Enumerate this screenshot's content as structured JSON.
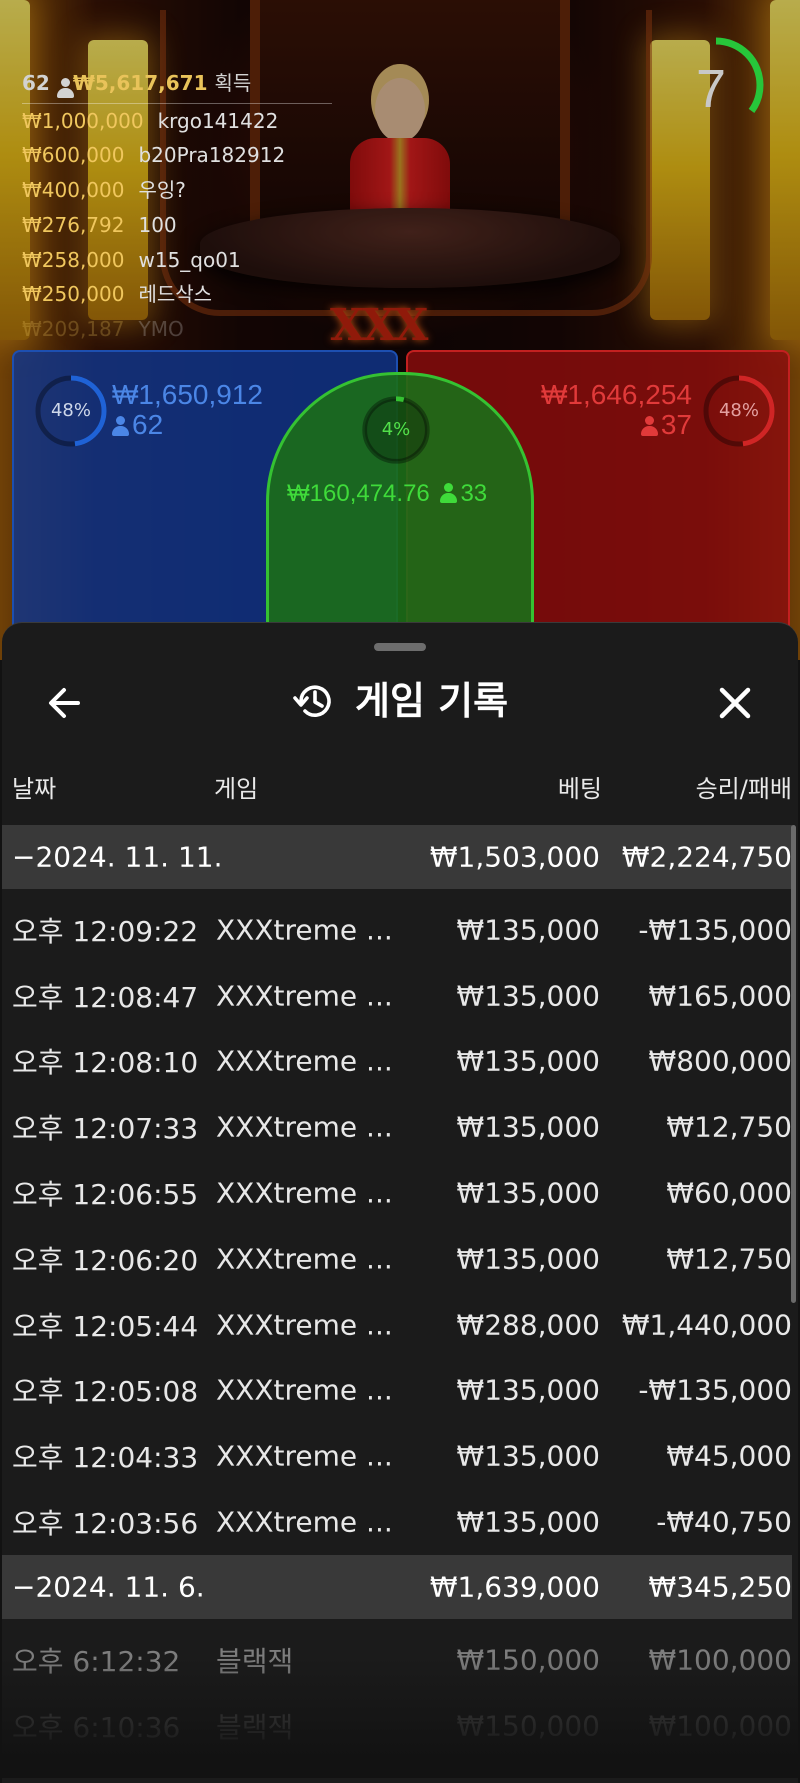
{
  "winners": {
    "header_count": "62",
    "header_total": "₩5,617,671",
    "header_suffix": "획득",
    "rows": [
      {
        "amount": "₩1,000,000",
        "name": "krgo141422"
      },
      {
        "amount": "₩600,000",
        "name": "b20Pra182912"
      },
      {
        "amount": "₩400,000",
        "name": "우잉?"
      },
      {
        "amount": "₩276,792",
        "name": "100"
      },
      {
        "amount": "₩258,000",
        "name": "w15_qo01"
      },
      {
        "amount": "₩250,000",
        "name": "레드삭스"
      },
      {
        "amount": "₩209,187",
        "name": "YMO"
      }
    ]
  },
  "timer": {
    "value": "7",
    "fraction": 0.35,
    "color": "#27c63a"
  },
  "zones": {
    "player": {
      "percent": "48%",
      "amount": "₩1,650,912",
      "players": "62",
      "fraction": 0.48,
      "color": "#1f62d6"
    },
    "tie": {
      "percent": "4%",
      "amount": "₩160,474.76",
      "players": "33",
      "fraction": 0.04,
      "color": "#35c232"
    },
    "banker": {
      "percent": "48%",
      "amount": "₩1,646,254",
      "players": "37",
      "fraction": 0.48,
      "color": "#d02525"
    }
  },
  "panel": {
    "title": "게임 기록",
    "icons": {
      "back": "arrow-left-icon",
      "close": "close-icon",
      "history": "history-icon"
    },
    "columns": {
      "date": "날짜",
      "game": "게임",
      "bet": "베팅",
      "result": "승리/패배"
    },
    "groups": [
      {
        "date": "−2024. 11. 11.",
        "bet_total": "₩1,503,000",
        "result_total": "₩2,224,750",
        "entries": [
          {
            "time": "오후 12:09:22",
            "game": "XXXtreme ...",
            "bet": "₩135,000",
            "result": "-₩135,000"
          },
          {
            "time": "오후 12:08:47",
            "game": "XXXtreme ...",
            "bet": "₩135,000",
            "result": "₩165,000"
          },
          {
            "time": "오후 12:08:10",
            "game": "XXXtreme ...",
            "bet": "₩135,000",
            "result": "₩800,000"
          },
          {
            "time": "오후 12:07:33",
            "game": "XXXtreme ...",
            "bet": "₩135,000",
            "result": "₩12,750"
          },
          {
            "time": "오후 12:06:55",
            "game": "XXXtreme ...",
            "bet": "₩135,000",
            "result": "₩60,000"
          },
          {
            "time": "오후 12:06:20",
            "game": "XXXtreme ...",
            "bet": "₩135,000",
            "result": "₩12,750"
          },
          {
            "time": "오후 12:05:44",
            "game": "XXXtreme ...",
            "bet": "₩288,000",
            "result": "₩1,440,000"
          },
          {
            "time": "오후 12:05:08",
            "game": "XXXtreme ...",
            "bet": "₩135,000",
            "result": "-₩135,000"
          },
          {
            "time": "오후 12:04:33",
            "game": "XXXtreme ...",
            "bet": "₩135,000",
            "result": "₩45,000"
          },
          {
            "time": "오후 12:03:56",
            "game": "XXXtreme ...",
            "bet": "₩135,000",
            "result": "-₩40,750"
          }
        ]
      },
      {
        "date": "−2024. 11. 6.",
        "bet_total": "₩1,639,000",
        "result_total": "₩345,250",
        "entries": [
          {
            "time": "오후 6:12:32",
            "game": "블랙잭",
            "bet": "₩150,000",
            "result": "₩100,000"
          },
          {
            "time": "오후 6:10:36",
            "game": "블랙잭",
            "bet": "₩150,000",
            "result": "₩100,000"
          }
        ]
      }
    ]
  }
}
